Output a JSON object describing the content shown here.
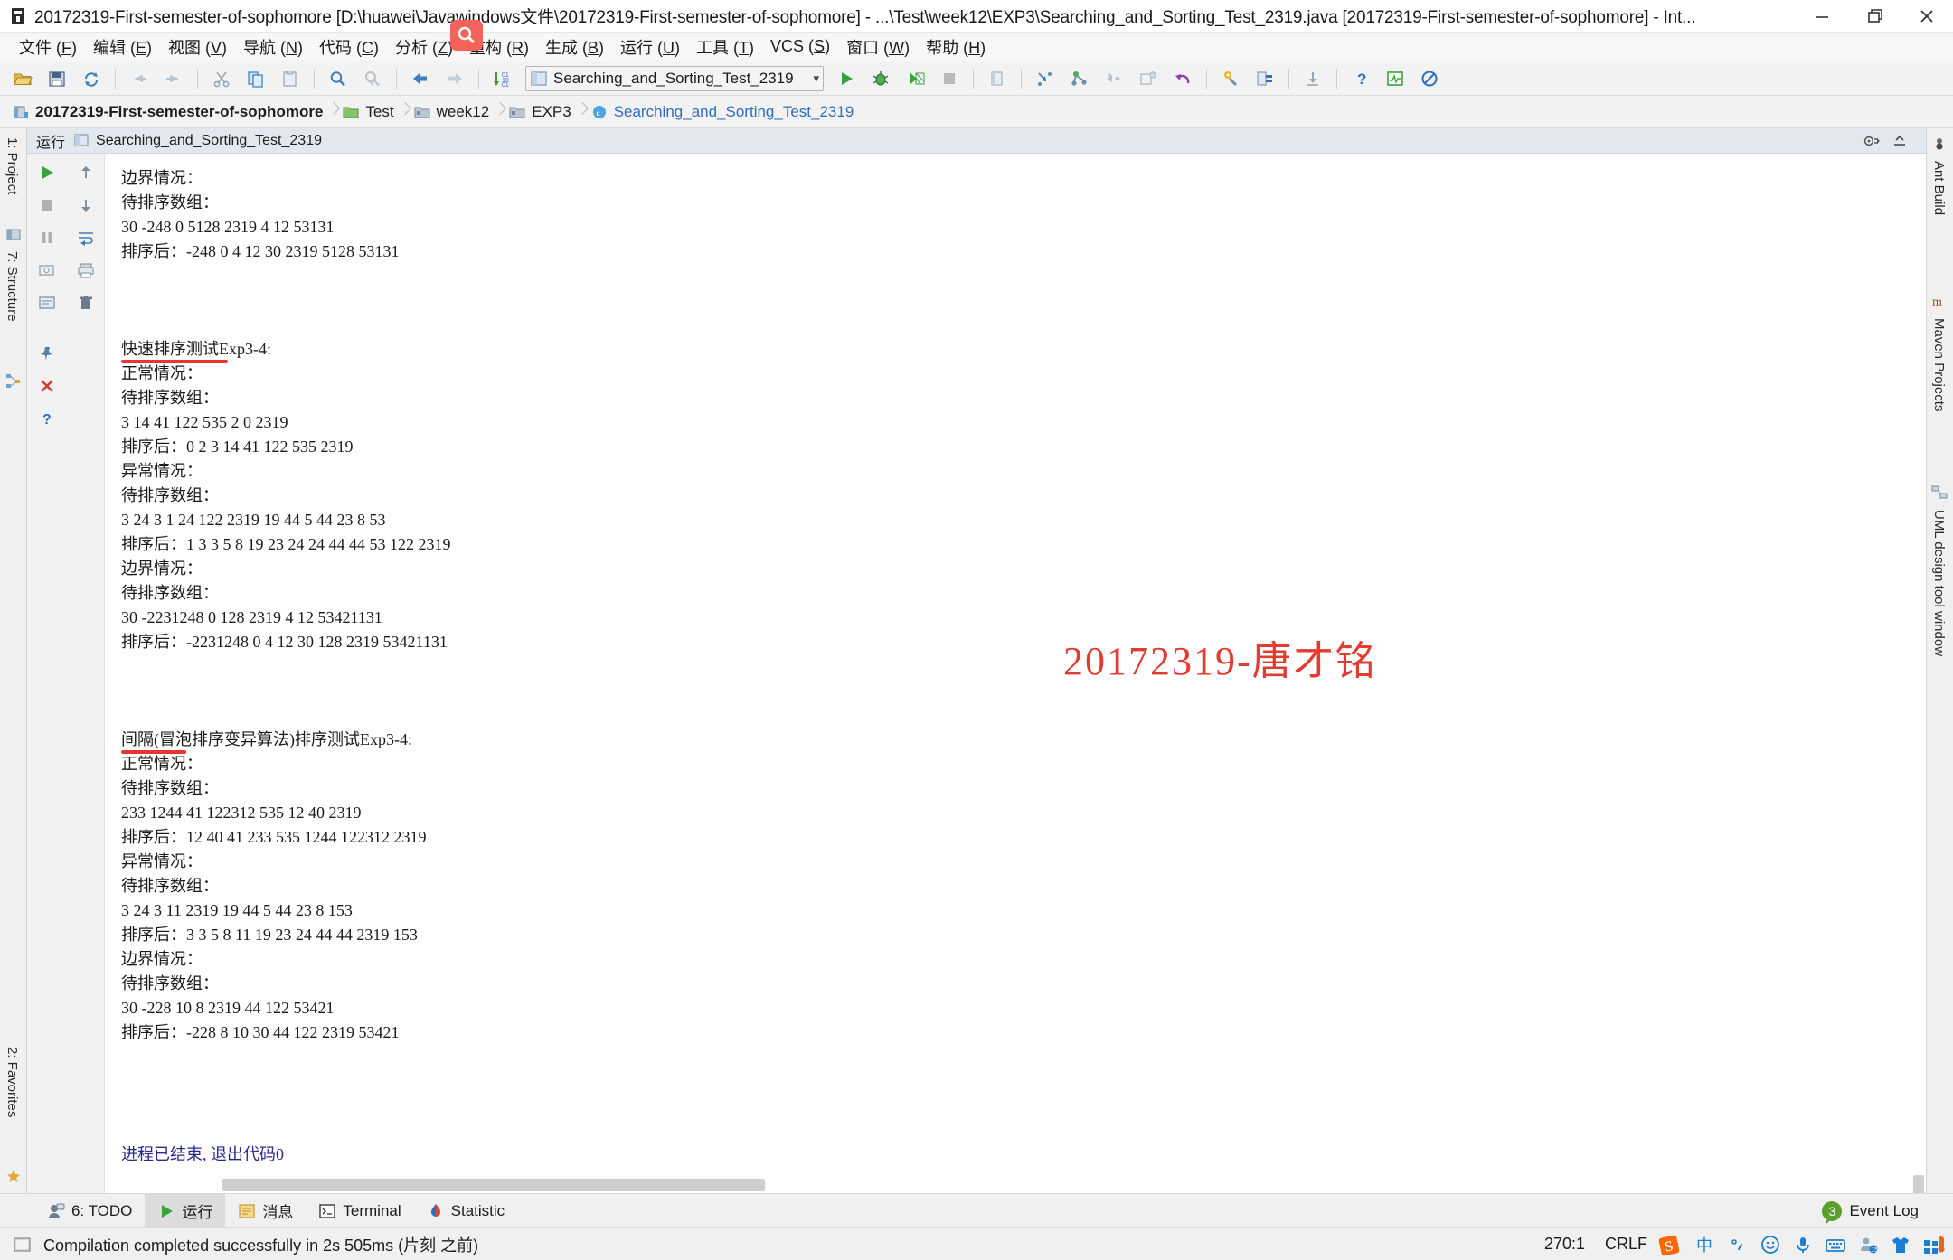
{
  "window": {
    "title": "20172319-First-semester-of-sophomore [D:\\huawei\\Javawindows文件\\20172319-First-semester-of-sophomore] - ...\\Test\\week12\\EXP3\\Searching_and_Sorting_Test_2319.java [20172319-First-semester-of-sophomore] - Int...",
    "minimize": "minimize-icon",
    "maximize": "maximize-icon",
    "close": "close-icon"
  },
  "menubar": [
    {
      "label": "文件",
      "mnemonic": "F"
    },
    {
      "label": "编辑",
      "mnemonic": "E"
    },
    {
      "label": "视图",
      "mnemonic": "V"
    },
    {
      "label": "导航",
      "mnemonic": "N"
    },
    {
      "label": "代码",
      "mnemonic": "C"
    },
    {
      "label": "分析",
      "mnemonic": "Z"
    },
    {
      "label": "重构",
      "mnemonic": "R"
    },
    {
      "label": "生成",
      "mnemonic": "B"
    },
    {
      "label": "运行",
      "mnemonic": "U"
    },
    {
      "label": "工具",
      "mnemonic": "T"
    },
    {
      "label": "VCS",
      "mnemonic": "S"
    },
    {
      "label": "窗口",
      "mnemonic": "W"
    },
    {
      "label": "帮助",
      "mnemonic": "H"
    }
  ],
  "toolbar": {
    "run_config": {
      "name": "Searching_and_Sorting_Test_2319",
      "chevron": "▾"
    },
    "icons": [
      "open-folder-icon",
      "save-all-icon",
      "sync-icon",
      "undo-icon",
      "redo-icon",
      "cut-icon",
      "copy-icon",
      "paste-icon",
      "find-icon",
      "replace-icon",
      "back-icon",
      "forward-icon",
      "sort-icon"
    ],
    "run_icons": [
      "run-icon",
      "debug-icon",
      "run-coverage-icon",
      "stop-icon",
      "run-dashboard-icon"
    ],
    "right_icons": [
      "step-into-icon",
      "branch-icon",
      "step-out-icon",
      "update-project-icon",
      "rollback-icon",
      "settings-icon",
      "project-structure-icon",
      "download-icon",
      "help-icon",
      "activity-monitor-icon",
      "no-inspection-icon"
    ],
    "search_overlay": "search-icon"
  },
  "breadcrumb": [
    {
      "label": "20172319-First-semester-of-sophomore",
      "icon": "module-icon",
      "kind": "root"
    },
    {
      "label": "Test",
      "icon": "source-folder-icon",
      "kind": "folder"
    },
    {
      "label": "week12",
      "icon": "folder-icon",
      "kind": "folder"
    },
    {
      "label": "EXP3",
      "icon": "folder-icon",
      "kind": "folder"
    },
    {
      "label": "Searching_and_Sorting_Test_2319",
      "icon": "java-class-icon",
      "kind": "file"
    }
  ],
  "left_tool_strip": [
    {
      "label": "1: Project",
      "icon": "project-icon"
    },
    {
      "label": "7: Structure",
      "icon": "structure-icon"
    },
    {
      "label": "2: Favorites",
      "icon": "favorites-icon"
    }
  ],
  "right_tool_strip": [
    {
      "label": "Ant Build",
      "icon": "ant-icon"
    },
    {
      "label": "Maven Projects",
      "icon": "maven-icon"
    },
    {
      "label": "UML design tool window",
      "icon": "uml-icon"
    }
  ],
  "run_window": {
    "title": "运行",
    "tab_name": "Searching_and_Sorting_Test_2319",
    "tab_icon": "run-config-icon",
    "settings_icon": "gear-icon",
    "hide_icon": "hide-window-icon",
    "gutter_icons": [
      "rerun-icon",
      "scroll-up-icon",
      "pause-icon",
      "scroll-down-icon",
      "stop-icon",
      "soft-wrap-icon",
      "print-screen-icon",
      "print-icon",
      "use-console-icon",
      "trash-icon",
      "pin-icon",
      "close-icon",
      "help-icon"
    ],
    "console_lines": [
      {
        "text": "边界情况：",
        "type": "plain"
      },
      {
        "text": "待排序数组：",
        "type": "plain"
      },
      {
        "text": "30 -248 0 5128 2319 4 12 53131",
        "type": "plain"
      },
      {
        "text": "排序后：-248 0 4 12 30 2319 5128 53131",
        "type": "plain"
      },
      {
        "text": "",
        "type": "blank"
      },
      {
        "text": "",
        "type": "blank"
      },
      {
        "text": "",
        "type": "blank"
      },
      {
        "text": "快速排序测试Exp3-4:",
        "type": "underlined"
      },
      {
        "text": "正常情况：",
        "type": "plain"
      },
      {
        "text": "待排序数组：",
        "type": "plain"
      },
      {
        "text": "3 14 41 122 535 2 0 2319",
        "type": "plain"
      },
      {
        "text": "排序后：0 2 3 14 41 122 535 2319",
        "type": "plain"
      },
      {
        "text": "异常情况：",
        "type": "plain"
      },
      {
        "text": "待排序数组：",
        "type": "plain"
      },
      {
        "text": "3 24 3 1 24 122 2319 19 44 5 44 23 8 53",
        "type": "plain"
      },
      {
        "text": "排序后：1 3 3 5 8 19 23 24 24 44 44 53 122 2319",
        "type": "plain"
      },
      {
        "text": "边界情况：",
        "type": "plain"
      },
      {
        "text": "待排序数组：",
        "type": "plain"
      },
      {
        "text": "30 -2231248 0 128 2319 4 12 53421131",
        "type": "plain"
      },
      {
        "text": "排序后：-2231248 0 4 12 30 128 2319 53421131",
        "type": "plain"
      },
      {
        "text": "",
        "type": "blank"
      },
      {
        "text": "",
        "type": "blank"
      },
      {
        "text": "",
        "type": "blank"
      },
      {
        "text": "间隔(冒泡排序变异算法)排序测试Exp3-4:",
        "type": "underlined-short"
      },
      {
        "text": "正常情况：",
        "type": "plain"
      },
      {
        "text": "待排序数组：",
        "type": "plain"
      },
      {
        "text": "233 1244 41 122312 535 12 40 2319",
        "type": "plain"
      },
      {
        "text": "排序后：12 40 41 233 535 1244 122312 2319",
        "type": "plain"
      },
      {
        "text": "异常情况：",
        "type": "plain"
      },
      {
        "text": "待排序数组：",
        "type": "plain"
      },
      {
        "text": "3 24 3 11 2319 19 44 5 44 23 8 153",
        "type": "plain"
      },
      {
        "text": "排序后：3 3 5 8 11 19 23 24 44 44 2319 153",
        "type": "plain"
      },
      {
        "text": "边界情况：",
        "type": "plain"
      },
      {
        "text": "待排序数组：",
        "type": "plain"
      },
      {
        "text": "30 -228 10 8 2319 44 122 53421",
        "type": "plain"
      },
      {
        "text": "排序后：-228 8 10 30 44 122 2319 53421",
        "type": "plain"
      },
      {
        "text": "",
        "type": "blank"
      },
      {
        "text": "",
        "type": "blank"
      },
      {
        "text": "",
        "type": "blank"
      },
      {
        "text": "",
        "type": "blank"
      },
      {
        "text": "进程已结束, 退出代码0",
        "type": "exit"
      }
    ],
    "watermark": "20172319-唐才铭",
    "watermark_color": "#e03c31",
    "underline_color": "#e8362c"
  },
  "bottom_tabs": [
    {
      "label": "6: TODO",
      "icon": "todo-icon",
      "selected": false
    },
    {
      "label": "运行",
      "icon": "run-icon",
      "selected": true
    },
    {
      "label": "消息",
      "icon": "messages-icon",
      "selected": false
    },
    {
      "label": "Terminal",
      "icon": "terminal-icon",
      "selected": false
    },
    {
      "label": "Statistic",
      "icon": "statistic-icon",
      "selected": false
    }
  ],
  "event_log": {
    "count": "3",
    "label": "Event Log"
  },
  "status_bar": {
    "icon": "compile-status-icon",
    "message": "Compilation completed successfully in 2s 505ms (片刻 之前)",
    "caret_position": "270:1",
    "line_separator": "CRLF",
    "tray_icons": [
      "sogou-icon",
      "chinese-input-icon",
      "punctuation-icon",
      "emoji-icon",
      "microphone-icon",
      "keyboard-icon",
      "contacts-icon",
      "skin-icon",
      "toolbox-icon"
    ]
  }
}
